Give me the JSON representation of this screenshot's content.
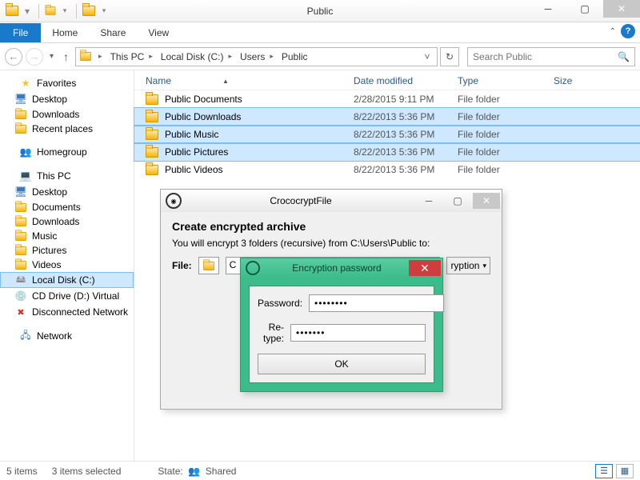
{
  "window": {
    "title": "Public"
  },
  "ribbon": {
    "file": "File",
    "tabs": [
      "Home",
      "Share",
      "View"
    ]
  },
  "breadcrumbs": [
    "This PC",
    "Local Disk (C:)",
    "Users",
    "Public"
  ],
  "search": {
    "placeholder": "Search Public"
  },
  "sidebar": {
    "favorites": {
      "label": "Favorites",
      "items": [
        "Desktop",
        "Downloads",
        "Recent places"
      ]
    },
    "homegroup": {
      "label": "Homegroup"
    },
    "thispc": {
      "label": "This PC",
      "items": [
        "Desktop",
        "Documents",
        "Downloads",
        "Music",
        "Pictures",
        "Videos",
        "Local Disk (C:)",
        "CD Drive (D:) Virtual",
        "Disconnected Network"
      ]
    },
    "network": {
      "label": "Network"
    }
  },
  "columns": {
    "name": "Name",
    "date": "Date modified",
    "type": "Type",
    "size": "Size"
  },
  "files": [
    {
      "name": "Public Documents",
      "date": "2/28/2015 9:11 PM",
      "type": "File folder",
      "selected": false
    },
    {
      "name": "Public Downloads",
      "date": "8/22/2013 5:36 PM",
      "type": "File folder",
      "selected": true
    },
    {
      "name": "Public Music",
      "date": "8/22/2013 5:36 PM",
      "type": "File folder",
      "selected": true
    },
    {
      "name": "Public Pictures",
      "date": "8/22/2013 5:36 PM",
      "type": "File folder",
      "selected": true
    },
    {
      "name": "Public Videos",
      "date": "8/22/2013 5:36 PM",
      "type": "File folder",
      "selected": false
    }
  ],
  "status": {
    "items": "5 items",
    "selected": "3 items selected",
    "state_label": "State:",
    "state_val": "Shared"
  },
  "crococrypt": {
    "title": "CrococryptFile",
    "heading": "Create encrypted archive",
    "info": "You will encrypt 3 folders (recursive) from C:\\Users\\Public to:",
    "file_label": "File:",
    "file_value": "C",
    "enc_suffix": "ryption"
  },
  "pwd": {
    "title": "Encryption password",
    "pw_label": "Password:",
    "retype_label": "Re-type:",
    "pw_mask": "••••••••",
    "retype_mask": "•••••••",
    "ok": "OK"
  }
}
